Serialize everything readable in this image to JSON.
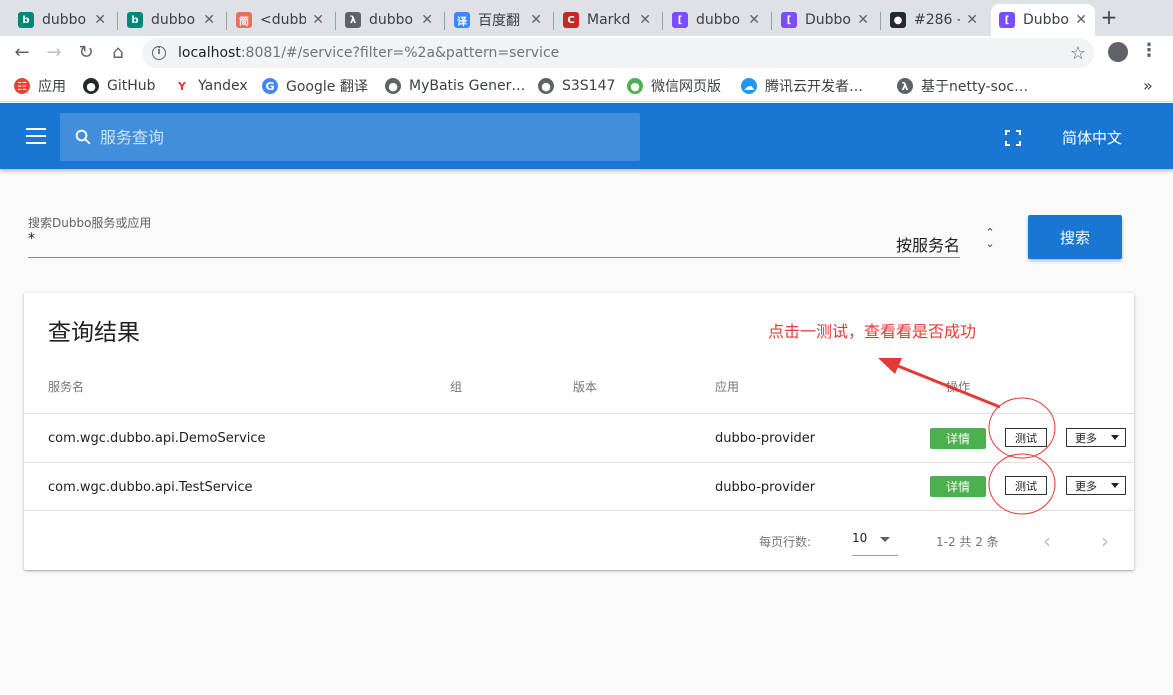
{
  "browser": {
    "tabs": [
      {
        "title": "dubbo",
        "icon": "bing-icon",
        "color": "#00897b",
        "glyph": "b"
      },
      {
        "title": "dubbo",
        "icon": "bing-icon",
        "color": "#00897b",
        "glyph": "b"
      },
      {
        "title": "<dubb",
        "icon": "jianshu-icon",
        "color": "#ea6f5a",
        "glyph": "简"
      },
      {
        "title": "dubbo",
        "icon": "netty-icon",
        "color": "#5f6368",
        "glyph": "λ"
      },
      {
        "title": "百度翻",
        "icon": "baidu-translate-icon",
        "color": "#4285f4",
        "glyph": "译"
      },
      {
        "title": "Markd",
        "icon": "csdn-icon",
        "color": "#c62828",
        "glyph": "C"
      },
      {
        "title": "dubbo",
        "icon": "dubbo-icon",
        "color": "#7c4dff",
        "glyph": "["
      },
      {
        "title": "Dubbo",
        "icon": "dubbo-icon",
        "color": "#7c4dff",
        "glyph": "["
      },
      {
        "title": "#286 -",
        "icon": "github-icon",
        "color": "#24292e",
        "glyph": "●"
      },
      {
        "title": "Dubbo",
        "icon": "dubbo-icon",
        "color": "#7c4dff",
        "glyph": "["
      }
    ],
    "active_tab_index": 9,
    "url_host": "localhost",
    "url_rest": ":8081/#/service?filter=%2a&pattern=service",
    "bookmarks": [
      {
        "label": "应用",
        "icon": "apps-grid-icon",
        "color": "#ea4335",
        "glyph": "☷"
      },
      {
        "label": "GitHub",
        "icon": "github-icon",
        "color": "#24292e",
        "glyph": "●"
      },
      {
        "label": "Yandex",
        "icon": "yandex-icon",
        "color": "#ffffff",
        "glyph": "Y"
      },
      {
        "label": "Google 翻译",
        "icon": "google-translate-icon",
        "color": "#4285f4",
        "glyph": "G"
      },
      {
        "label": "MyBatis Gener…",
        "icon": "globe-icon",
        "color": "#5f6368",
        "glyph": "●"
      },
      {
        "label": "S3S147",
        "icon": "globe-icon",
        "color": "#5f6368",
        "glyph": "●"
      },
      {
        "label": "微信网页版",
        "icon": "wechat-icon",
        "color": "#4caf50",
        "glyph": "●"
      },
      {
        "label": "腾讯云开发者…",
        "icon": "tencent-cloud-icon",
        "color": "#2196f3",
        "glyph": "☁"
      },
      {
        "label": "基于netty-soc…",
        "icon": "netty-icon",
        "color": "#5f6368",
        "glyph": "λ"
      }
    ]
  },
  "appbar": {
    "search_placeholder": "服务查询",
    "language": "简体中文"
  },
  "search_form": {
    "label": "搜索Dubbo服务或应用",
    "value": "*",
    "pattern": "按服务名",
    "button": "搜索"
  },
  "results": {
    "title": "查询结果",
    "headers": {
      "service": "服务名",
      "group": "组",
      "version": "版本",
      "app": "应用",
      "ops": "操作"
    },
    "rows": [
      {
        "service": "com.wgc.dubbo.api.DemoService",
        "group": "",
        "version": "",
        "app": "dubbo-provider",
        "detail": "详情",
        "test": "测试",
        "more": "更多"
      },
      {
        "service": "com.wgc.dubbo.api.TestService",
        "group": "",
        "version": "",
        "app": "dubbo-provider",
        "detail": "详情",
        "test": "测试",
        "more": "更多"
      }
    ],
    "rows_per_page_label": "每页行数:",
    "rows_per_page": "10",
    "range_text": "1-2 共 2 条"
  },
  "annotation": {
    "text": "点击一测试，查看看是否成功",
    "color": "#e53935"
  }
}
